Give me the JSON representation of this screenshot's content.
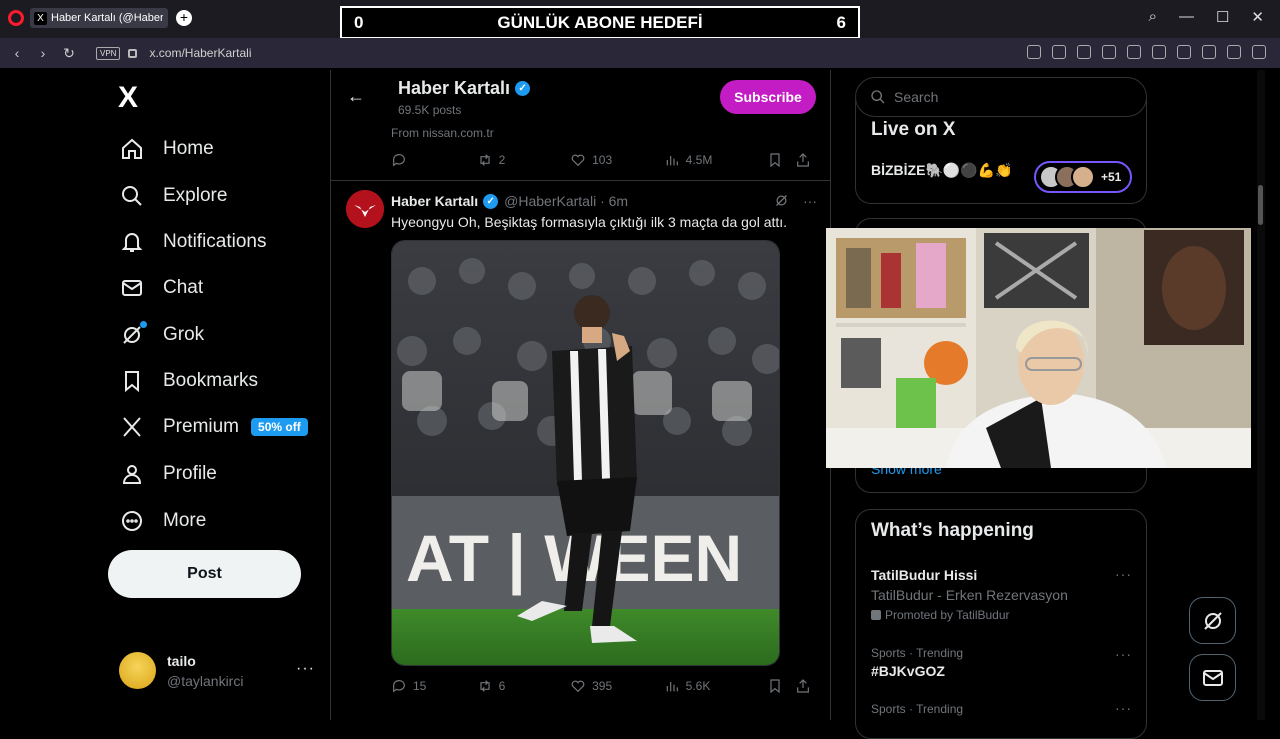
{
  "browser": {
    "tab_title": "Haber Kartalı (@HaberKar",
    "tab_close": "×",
    "new_tab": "+",
    "vpn_label": "VPN",
    "url": "x.com/HaberKartali",
    "nav_back": "‹",
    "nav_forward": "›",
    "reload": "↻",
    "window_controls": {
      "search": "⌕",
      "minimize": "—",
      "maximize": "☐",
      "close": "✕"
    }
  },
  "overlay_goal": {
    "left_count": "0",
    "title": "GÜNLÜK ABONE HEDEFİ",
    "right_count": "6"
  },
  "sidebar": {
    "logo": "X",
    "items": [
      {
        "label": "Home",
        "icon": "home-icon"
      },
      {
        "label": "Explore",
        "icon": "search-icon"
      },
      {
        "label": "Notifications",
        "icon": "bell-icon"
      },
      {
        "label": "Chat",
        "icon": "mail-icon"
      },
      {
        "label": "Grok",
        "icon": "grok-icon"
      },
      {
        "label": "Bookmarks",
        "icon": "bookmark-icon"
      },
      {
        "label": "Premium",
        "icon": "x-icon"
      },
      {
        "label": "Profile",
        "icon": "person-icon"
      },
      {
        "label": "More",
        "icon": "more-circle-icon"
      }
    ],
    "premium_badge": "50% off",
    "post_button": "Post",
    "user": {
      "name": "tailo",
      "handle": "@taylankirci",
      "more": "···"
    }
  },
  "profile_header": {
    "back": "←",
    "name": "Haber Kartalı",
    "verified": "✓",
    "posts": "69.5K posts",
    "subscribe": "Subscribe"
  },
  "prev_tweet": {
    "source": "From nissan.com.tr",
    "replies": "",
    "retweets": "2",
    "likes": "103",
    "views": "4.5M"
  },
  "tweet": {
    "avatar_letter": "",
    "name": "Haber Kartalı",
    "verified": "✓",
    "handle": "@HaberKartali · 6m",
    "text": "Hyeongyu Oh, Beşiktaş formasıyla çıktığı ilk 3 maçta da gol attı.",
    "more": "···",
    "banner_text": "AT | WEEN",
    "replies": "15",
    "retweets": "6",
    "likes": "395",
    "views": "5.6K"
  },
  "right": {
    "search_placeholder": "Search",
    "live_title": "Live on X",
    "live_name": "BİZBİZE🐘⚪⚫💪👏",
    "live_count": "+51",
    "show_more": "Show more",
    "whats_happening": "What’s happening",
    "trends": [
      {
        "title": "TatilBudur Hissi",
        "sub": "TatilBudur - Erken Rezervasyon",
        "promo": "Promoted by TatilBudur"
      },
      {
        "context": "Sports · Trending",
        "title": "#BJKvGOZ"
      },
      {
        "context": "Sports · Trending"
      }
    ],
    "trend_more": "···"
  },
  "colors": {
    "accent": "#1d9bf0",
    "subscribe": "#c31cc4",
    "border": "#2f3336",
    "muted": "#71767b"
  }
}
